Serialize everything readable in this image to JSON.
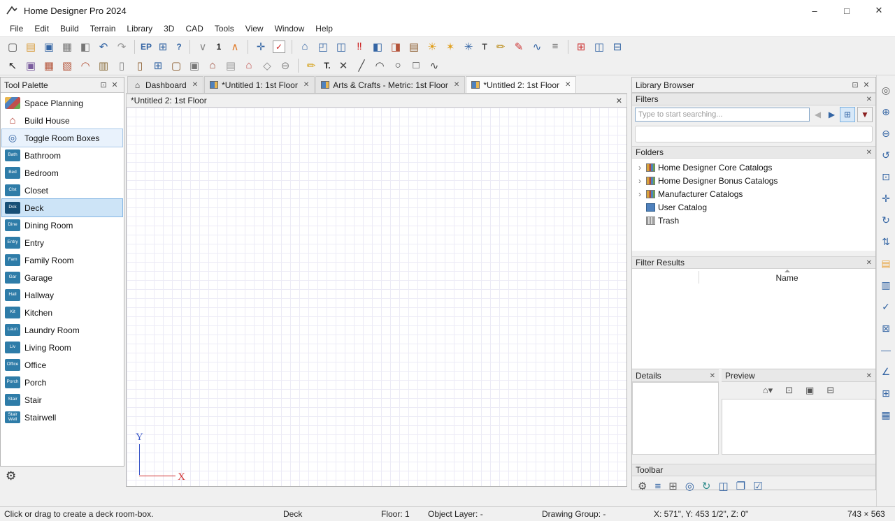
{
  "window": {
    "title": "Home Designer Pro 2024",
    "controls": [
      {
        "name": "minimize-button",
        "glyph": "–"
      },
      {
        "name": "maximize-button",
        "glyph": "□"
      },
      {
        "name": "close-button",
        "glyph": "✕"
      }
    ]
  },
  "menu_bar": {
    "items": [
      {
        "name": "menu-file",
        "label": "File"
      },
      {
        "name": "menu-edit",
        "label": "Edit"
      },
      {
        "name": "menu-build",
        "label": "Build"
      },
      {
        "name": "menu-terrain",
        "label": "Terrain"
      },
      {
        "name": "menu-library",
        "label": "Library"
      },
      {
        "name": "menu-3d",
        "label": "3D"
      },
      {
        "name": "menu-cad",
        "label": "CAD"
      },
      {
        "name": "menu-tools",
        "label": "Tools"
      },
      {
        "name": "menu-view",
        "label": "View"
      },
      {
        "name": "menu-window",
        "label": "Window"
      },
      {
        "name": "menu-help",
        "label": "Help"
      }
    ]
  },
  "toolbar_top": {
    "icons": [
      {
        "name": "new-plan-icon",
        "glyph": "▢",
        "color": "#555"
      },
      {
        "name": "open-plan-icon",
        "glyph": "▤",
        "color": "#d79b3a"
      },
      {
        "name": "save-plan-icon",
        "glyph": "▣",
        "color": "#3465a4"
      },
      {
        "name": "print-icon",
        "glyph": "▦",
        "color": "#777"
      },
      {
        "name": "print-preview-icon",
        "glyph": "◧",
        "color": "#777"
      },
      {
        "name": "undo-icon",
        "glyph": "↶",
        "color": "#3465a4"
      },
      {
        "name": "redo-icon",
        "glyph": "↷",
        "color": "#9a9a9a"
      },
      {
        "name": "toolbar-separator",
        "cls": "sep",
        "inter": "false"
      },
      {
        "name": "edit-preferences-icon",
        "glyph": "EP",
        "color": "#3465a4",
        "cls": "txt"
      },
      {
        "name": "active-defaults-icon",
        "glyph": "⊞",
        "color": "#3465a4"
      },
      {
        "name": "help-icon",
        "glyph": "?",
        "color": "#3465a4",
        "cls": "txt"
      },
      {
        "name": "toolbar-separator",
        "cls": "sep",
        "inter": "false"
      },
      {
        "name": "floor-down-icon",
        "glyph": "∨",
        "color": "#8a8a8a"
      },
      {
        "name": "floor-indicator",
        "glyph": "1",
        "color": "#222",
        "cls": "txt",
        "inter": "false"
      },
      {
        "name": "floor-up-icon",
        "glyph": "∧",
        "color": "#e07b2a"
      },
      {
        "name": "toolbar-separator",
        "cls": "sep",
        "inter": "false"
      },
      {
        "name": "touch-pan-icon",
        "glyph": "✛",
        "color": "#3465a4"
      },
      {
        "name": "auto-check-plan-icon",
        "glyph": "✓",
        "color": "#cc2222",
        "cls": "boxed"
      },
      {
        "name": "toolbar-separator",
        "cls": "sep",
        "inter": "false"
      },
      {
        "name": "camera-view-icon",
        "glyph": "⌂",
        "color": "#3465a4"
      },
      {
        "name": "overview-icon",
        "glyph": "◰",
        "color": "#3465a4"
      },
      {
        "name": "doll-house-view-icon",
        "glyph": "◫",
        "color": "#3465a4"
      },
      {
        "name": "walkthrough-icon",
        "glyph": "‼",
        "color": "#cc2222"
      },
      {
        "name": "cross-section-icon",
        "glyph": "◧",
        "color": "#3465a4"
      },
      {
        "name": "wall-elevation-icon",
        "glyph": "◨",
        "color": "#b4543a"
      },
      {
        "name": "framing-overview-icon",
        "glyph": "▤",
        "color": "#8a5a2b"
      },
      {
        "name": "sun-angle-icon",
        "glyph": "☀",
        "color": "#e0a020"
      },
      {
        "name": "add-light-icon",
        "glyph": "✶",
        "color": "#e0a020"
      },
      {
        "name": "adjust-lights-icon",
        "glyph": "✳",
        "color": "#3465a4"
      },
      {
        "name": "text-tool-icon",
        "glyph": "T",
        "color": "#444",
        "cls": "txt"
      },
      {
        "name": "input-line-icon",
        "glyph": "✏",
        "color": "#b8860b"
      },
      {
        "name": "edit-drawing-icon",
        "glyph": "✎",
        "color": "#cc3333"
      },
      {
        "name": "curve-tool-icon",
        "glyph": "∿",
        "color": "#3465a4"
      },
      {
        "name": "layers-icon",
        "glyph": "≡",
        "color": "#777"
      },
      {
        "name": "toolbar-separator",
        "cls": "sep",
        "inter": "false"
      },
      {
        "name": "toolbars-config-icon",
        "glyph": "⊞",
        "color": "#cc3333"
      },
      {
        "name": "tile-windows-icon",
        "glyph": "◫",
        "color": "#3465a4"
      },
      {
        "name": "panel-layout-icon",
        "glyph": "⊟",
        "color": "#3465a4"
      }
    ]
  },
  "toolbar_build": {
    "icons": [
      {
        "name": "select-objects-icon",
        "glyph": "↖",
        "color": "#222"
      },
      {
        "name": "library-object-icon",
        "glyph": "▣",
        "color": "#7a5c9e"
      },
      {
        "name": "exterior-wall-icon",
        "glyph": "▦",
        "color": "#b4543a"
      },
      {
        "name": "interior-wall-icon",
        "glyph": "▧",
        "color": "#b4543a"
      },
      {
        "name": "curved-wall-icon",
        "glyph": "◠",
        "color": "#b4543a"
      },
      {
        "name": "railing-icon",
        "glyph": "▥",
        "color": "#8a6d3b"
      },
      {
        "name": "column-icon",
        "glyph": "▯",
        "color": "#888"
      },
      {
        "name": "door-tool-icon",
        "glyph": "▯",
        "color": "#8a5a2b"
      },
      {
        "name": "window-tool-icon",
        "glyph": "⊞",
        "color": "#3465a4"
      },
      {
        "name": "cabinet-tool-icon",
        "glyph": "▢",
        "color": "#8a5a2b"
      },
      {
        "name": "fixtures-icon",
        "glyph": "▣",
        "color": "#777"
      },
      {
        "name": "fireplace-icon",
        "glyph": "⌂",
        "color": "#994433"
      },
      {
        "name": "stairs-icon",
        "glyph": "▤",
        "color": "#999"
      },
      {
        "name": "roof-tool-icon",
        "glyph": "⌂",
        "color": "#c0504d"
      },
      {
        "name": "ceiling-plane-icon",
        "glyph": "◇",
        "color": "#888"
      },
      {
        "name": "eraser-icon",
        "glyph": "⊖",
        "color": "#888"
      },
      {
        "name": "toolbar-separator",
        "cls": "sep",
        "inter": "false"
      },
      {
        "name": "dimension-tool-icon",
        "glyph": "✏",
        "color": "#d4a017"
      },
      {
        "name": "text-icon",
        "glyph": "T.",
        "color": "#222",
        "cls": "txt"
      },
      {
        "name": "cross-box-icon",
        "glyph": "✕",
        "color": "#444"
      },
      {
        "name": "draw-line-icon",
        "glyph": "╱",
        "color": "#444"
      },
      {
        "name": "draw-arc-icon",
        "glyph": "◠",
        "color": "#444"
      },
      {
        "name": "draw-circle-icon",
        "glyph": "○",
        "color": "#444"
      },
      {
        "name": "draw-box-icon",
        "glyph": "□",
        "color": "#444"
      },
      {
        "name": "draw-spline-icon",
        "glyph": "∿",
        "color": "#444"
      }
    ]
  },
  "panel_icons": {
    "float": "⊡",
    "close": "✕"
  },
  "tool_palette": {
    "title": "Tool Palette",
    "items": [
      {
        "name": "palette-item-space-planning",
        "label": "Space Planning",
        "badge": "",
        "badge_class": "sp-badge",
        "icon_name": "space-planning-icon"
      },
      {
        "name": "palette-item-build-house",
        "label": "Build House",
        "badge": "⌂",
        "badge_class": "house-badge",
        "icon_name": "build-house-icon"
      },
      {
        "name": "palette-item-toggle-room-boxes",
        "label": "Toggle Room Boxes",
        "badge": "◎",
        "badge_class": "toggle-badge",
        "icon_name": "toggle-room-boxes-icon",
        "row_class": "checked"
      },
      {
        "name": "palette-item-bathroom",
        "label": "Bathroom",
        "badge": "Bath",
        "badge_class": "abbr-badge",
        "icon_name": "bathroom-icon"
      },
      {
        "name": "palette-item-bedroom",
        "label": "Bedroom",
        "badge": "Bed",
        "badge_class": "abbr-badge",
        "icon_name": "bedroom-icon"
      },
      {
        "name": "palette-item-closet",
        "label": "Closet",
        "badge": "Clst",
        "badge_class": "abbr-badge",
        "icon_name": "closet-icon"
      },
      {
        "name": "palette-item-deck",
        "label": "Deck",
        "badge": "Dck",
        "badge_class": "abbr-badge",
        "icon_name": "deck-icon",
        "row_class": "selected"
      },
      {
        "name": "palette-item-dining-room",
        "label": "Dining Room",
        "badge": "Dine",
        "badge_class": "abbr-badge",
        "icon_name": "dining-room-icon"
      },
      {
        "name": "palette-item-entry",
        "label": "Entry",
        "badge": "Entry",
        "badge_class": "abbr-badge",
        "icon_name": "entry-icon"
      },
      {
        "name": "palette-item-family-room",
        "label": "Family Room",
        "badge": "Fam",
        "badge_class": "abbr-badge",
        "icon_name": "family-room-icon"
      },
      {
        "name": "palette-item-garage",
        "label": "Garage",
        "badge": "Gar",
        "badge_class": "abbr-badge",
        "icon_name": "garage-icon"
      },
      {
        "name": "palette-item-hallway",
        "label": "Hallway",
        "badge": "Hall",
        "badge_class": "abbr-badge",
        "icon_name": "hallway-icon"
      },
      {
        "name": "palette-item-kitchen",
        "label": "Kitchen",
        "badge": "Kit",
        "badge_class": "abbr-badge",
        "icon_name": "kitchen-icon"
      },
      {
        "name": "palette-item-laundry-room",
        "label": "Laundry Room",
        "badge": "Laun",
        "badge_class": "abbr-badge",
        "icon_name": "laundry-room-icon"
      },
      {
        "name": "palette-item-living-room",
        "label": "Living Room",
        "badge": "Liv",
        "badge_class": "abbr-badge",
        "icon_name": "living-room-icon"
      },
      {
        "name": "palette-item-office",
        "label": "Office",
        "badge": "Office",
        "badge_class": "abbr-badge",
        "icon_name": "office-icon"
      },
      {
        "name": "palette-item-porch",
        "label": "Porch",
        "badge": "Porch",
        "badge_class": "abbr-badge",
        "icon_name": "porch-icon"
      },
      {
        "name": "palette-item-stair",
        "label": "Stair",
        "badge": "Stair",
        "badge_class": "abbr-badge",
        "icon_name": "stair-icon"
      },
      {
        "name": "palette-item-stairwell",
        "label": "Stairwell",
        "badge": "Stair Well",
        "badge_class": "abbr-badge",
        "icon_name": "stairwell-icon"
      }
    ]
  },
  "tabs": {
    "items": [
      {
        "name": "tab-dashboard",
        "label": "Dashboard",
        "icon": "dashboard-tab-icon",
        "close": "✕"
      },
      {
        "name": "tab-untitled-1",
        "label": "*Untitled 1: 1st Floor",
        "icon": "plan-tab-icon",
        "close": "✕"
      },
      {
        "name": "tab-arts-crafts-metric",
        "label": "Arts & Crafts - Metric: 1st Floor",
        "icon": "plan-tab-icon",
        "close": "✕"
      },
      {
        "name": "tab-untitled-2",
        "label": "*Untitled 2: 1st Floor",
        "icon": "plan-tab-icon",
        "close": "✕",
        "cls": "active"
      }
    ]
  },
  "document": {
    "title": "*Untitled 2: 1st Floor",
    "axis_x": "X",
    "axis_y": "Y"
  },
  "library": {
    "title": "Library Browser",
    "sections": {
      "filters": "Filters",
      "folders": "Folders",
      "filter_results": "Filter Results",
      "details": "Details",
      "preview": "Preview",
      "toolbar": "Toolbar"
    },
    "search": {
      "placeholder": "Type to start searching...",
      "controls": [
        {
          "name": "search-back-icon",
          "glyph": "◀",
          "color": "#b0b0b0",
          "cls": "flat"
        },
        {
          "name": "search-forward-icon",
          "glyph": "▶",
          "color": "#3465a4",
          "cls": "flat"
        },
        {
          "name": "search-mode-button",
          "glyph": "⊞",
          "color": "#3465a4",
          "cls": "pressed"
        },
        {
          "name": "filter-button",
          "glyph": "▼",
          "color": "#8b2020"
        }
      ]
    },
    "folders": [
      {
        "name": "folder-home-designer-core-catalogs",
        "label": "Home Designer Core Catalogs",
        "icon": "catalog-books-icon",
        "expander": "›"
      },
      {
        "name": "folder-home-designer-bonus-catalogs",
        "label": "Home Designer Bonus Catalogs",
        "icon": "catalog-books-icon",
        "expander": "›"
      },
      {
        "name": "folder-manufacturer-catalogs",
        "label": "Manufacturer Catalogs",
        "icon": "catalog-books-icon",
        "expander": "›"
      },
      {
        "name": "folder-user-catalog",
        "label": "User Catalog",
        "icon": "user-catalog-icon",
        "expander": ""
      },
      {
        "name": "folder-trash",
        "label": "Trash",
        "icon": "trash-icon",
        "expander": ""
      }
    ],
    "results_column": "Name",
    "preview_icons": [
      {
        "name": "preview-view-button",
        "glyph": "⌂▾",
        "color": "#555"
      },
      {
        "name": "preview-fill-window-icon",
        "glyph": "⊡",
        "color": "#555"
      },
      {
        "name": "preview-export-icon",
        "glyph": "▣",
        "color": "#555"
      },
      {
        "name": "preview-section-icon",
        "glyph": "⊟",
        "color": "#555"
      }
    ],
    "toolbar_icons": [
      {
        "name": "library-settings-gear-icon",
        "glyph": "⚙",
        "color": "#555"
      },
      {
        "name": "edit-list-icon",
        "glyph": "≡",
        "color": "#3465a4"
      },
      {
        "name": "thumbnails-icon",
        "glyph": "⊞",
        "color": "#666"
      },
      {
        "name": "library-search-icon",
        "glyph": "◎",
        "color": "#3465a4"
      },
      {
        "name": "update-catalogs-icon",
        "glyph": "↻",
        "color": "#2e8b8b"
      },
      {
        "name": "panels-icon",
        "glyph": "◫",
        "color": "#3465a4"
      },
      {
        "name": "cascade-windows-icon",
        "glyph": "❐",
        "color": "#3465a4"
      },
      {
        "name": "auto-filter-check-icon",
        "glyph": "☑",
        "color": "#3465a4"
      }
    ]
  },
  "right_rail": {
    "icons": [
      {
        "name": "zoom-icon",
        "glyph": "◎",
        "color": "#555"
      },
      {
        "name": "zoom-in-icon",
        "glyph": "⊕",
        "color": "#3465a4"
      },
      {
        "name": "zoom-out-icon",
        "glyph": "⊖",
        "color": "#3465a4"
      },
      {
        "name": "undo-zoom-icon",
        "glyph": "↺",
        "color": "#3465a4"
      },
      {
        "name": "fill-window-icon",
        "glyph": "⊡",
        "color": "#3465a4"
      },
      {
        "name": "pan-window-icon",
        "glyph": "✛",
        "color": "#3465a4"
      },
      {
        "name": "refresh-display-icon",
        "glyph": "↻",
        "color": "#3465a4"
      },
      {
        "name": "scrollbars-icon",
        "glyph": "⇅",
        "color": "#3465a4"
      },
      {
        "name": "library-browser-icon",
        "glyph": "▤",
        "color": "#e8a33d"
      },
      {
        "name": "project-browser-icon",
        "glyph": "▥",
        "color": "#3465a4"
      },
      {
        "name": "plan-check-icon",
        "glyph": "✓",
        "color": "#3465a4"
      },
      {
        "name": "edit-area-icon",
        "glyph": "⊠",
        "color": "#3465a4"
      },
      {
        "name": "tape-measure-icon",
        "glyph": "―",
        "color": "#3465a4"
      },
      {
        "name": "angle-snaps-icon",
        "glyph": "∠",
        "color": "#3465a4"
      },
      {
        "name": "object-snaps-icon",
        "glyph": "⊞",
        "color": "#3465a4"
      },
      {
        "name": "grid-snaps-icon",
        "glyph": "▦",
        "color": "#3465a4"
      }
    ]
  },
  "misc": {
    "palette_gear": "⚙"
  },
  "status_bar": {
    "hint": "Click or drag to create a deck room-box.",
    "tool": "Deck",
    "floor": "Floor: 1",
    "object_layer": "Object Layer: -",
    "drawing_group": "Drawing Group: -",
    "coordinates": "X: 571\", Y: 453 1/2\", Z: 0\"",
    "size": "743 × 563"
  }
}
